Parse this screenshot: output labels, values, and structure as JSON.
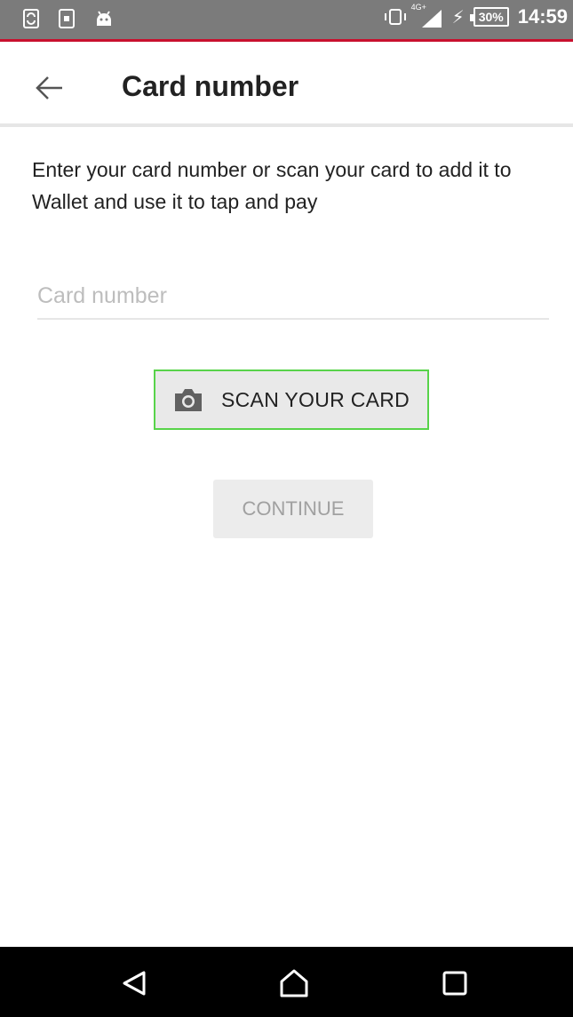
{
  "status_bar": {
    "time": "14:59",
    "battery": "30%",
    "network": "4G+",
    "left_icons": [
      "sync-icon",
      "sim-icon",
      "android-icon"
    ],
    "right_icons": [
      "vibrate-icon",
      "signal-icon",
      "charging-icon",
      "battery-icon"
    ]
  },
  "header": {
    "title": "Card number",
    "back_icon": "arrow-back-icon"
  },
  "main": {
    "description": "Enter your card number or scan your card to add it to Wallet and use it to tap and pay",
    "card_input": {
      "value": "",
      "placeholder": "Card number"
    },
    "scan_button": {
      "label": "SCAN YOUR CARD",
      "icon": "camera-icon"
    },
    "continue_button": {
      "label": "CONTINUE"
    }
  },
  "nav_bar": {
    "buttons": [
      "back-icon",
      "home-icon",
      "recents-icon"
    ]
  },
  "colors": {
    "status_bar_bg": "#7b7b7b",
    "status_accent": "#c8102e",
    "scan_highlight": "#58d34a",
    "disabled_text": "#a0a0a0"
  }
}
